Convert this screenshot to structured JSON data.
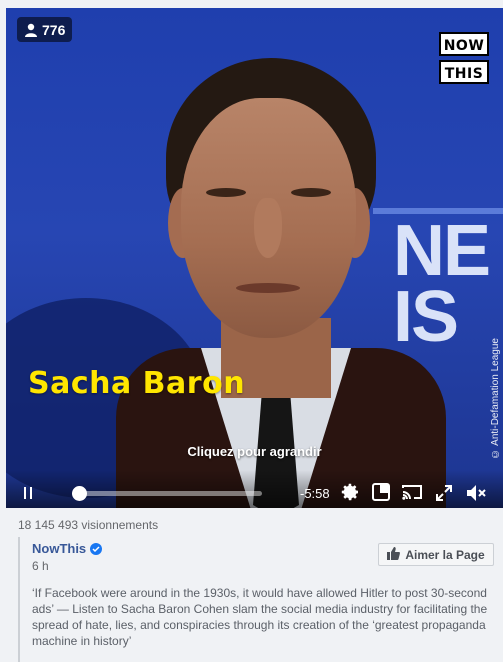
{
  "video": {
    "viewer_count": "776",
    "brand_logo": [
      "NOW",
      "THIS"
    ],
    "caption": "Sacha Baron",
    "credit": "© Anti-Defamation League",
    "background_letters": [
      "NE",
      "IS"
    ],
    "enlarge_hint": "Cliquez pour agrandir",
    "controls": {
      "time_remaining": "-5:58",
      "progress_fraction": 0.02,
      "icons": [
        "pause-icon",
        "gear-icon",
        "picture-in-picture-icon",
        "cast-icon",
        "fullscreen-icon",
        "mute-icon"
      ]
    },
    "colors": {
      "caption": "#ffe600",
      "background": "#2746b3"
    }
  },
  "views": "18 145 493 visionnements",
  "post": {
    "author": "NowThis",
    "time_ago": "6 h",
    "like_button": "Aimer la Page",
    "text": "‘If Facebook were around in the 1930s, it would have allowed Hitler to post 30-second ads’ — Listen to Sacha Baron Cohen slam the social media industry for facilitating the spread of hate, lies, and conspiracies through its creation of the ‘greatest propaganda machine in history’"
  }
}
